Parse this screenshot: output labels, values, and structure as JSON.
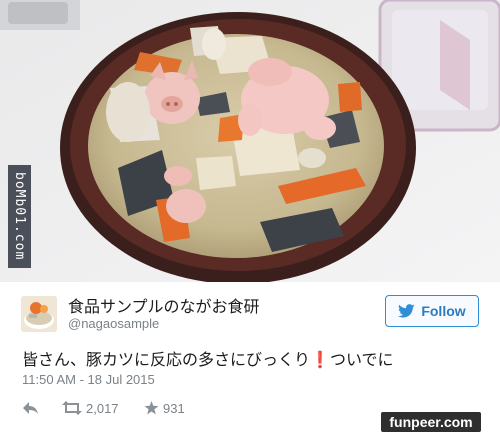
{
  "side_tag": {
    "text": "boMb01.com"
  },
  "tweet": {
    "display_name": "食品サンプルのながお食研",
    "handle": "@nagaosample",
    "follow_label": "Follow",
    "text_main": "皆さん、豚カツに反応の多さにびっくり",
    "text_mark": "❗",
    "text_tail": "ついでに",
    "timestamp": "11:50 AM - 18 Jul 2015",
    "retweets": "2,017",
    "favorites": "931"
  },
  "watermark": {
    "text": "funpeer.com"
  },
  "icons": {
    "reply": "reply-icon",
    "retweet": "retweet-icon",
    "favorite": "star-icon",
    "follow": "twitter-bird-icon"
  },
  "colors": {
    "accent": "#2b7bbf",
    "muted": "#7a8288",
    "exclamation": "#d42020"
  }
}
